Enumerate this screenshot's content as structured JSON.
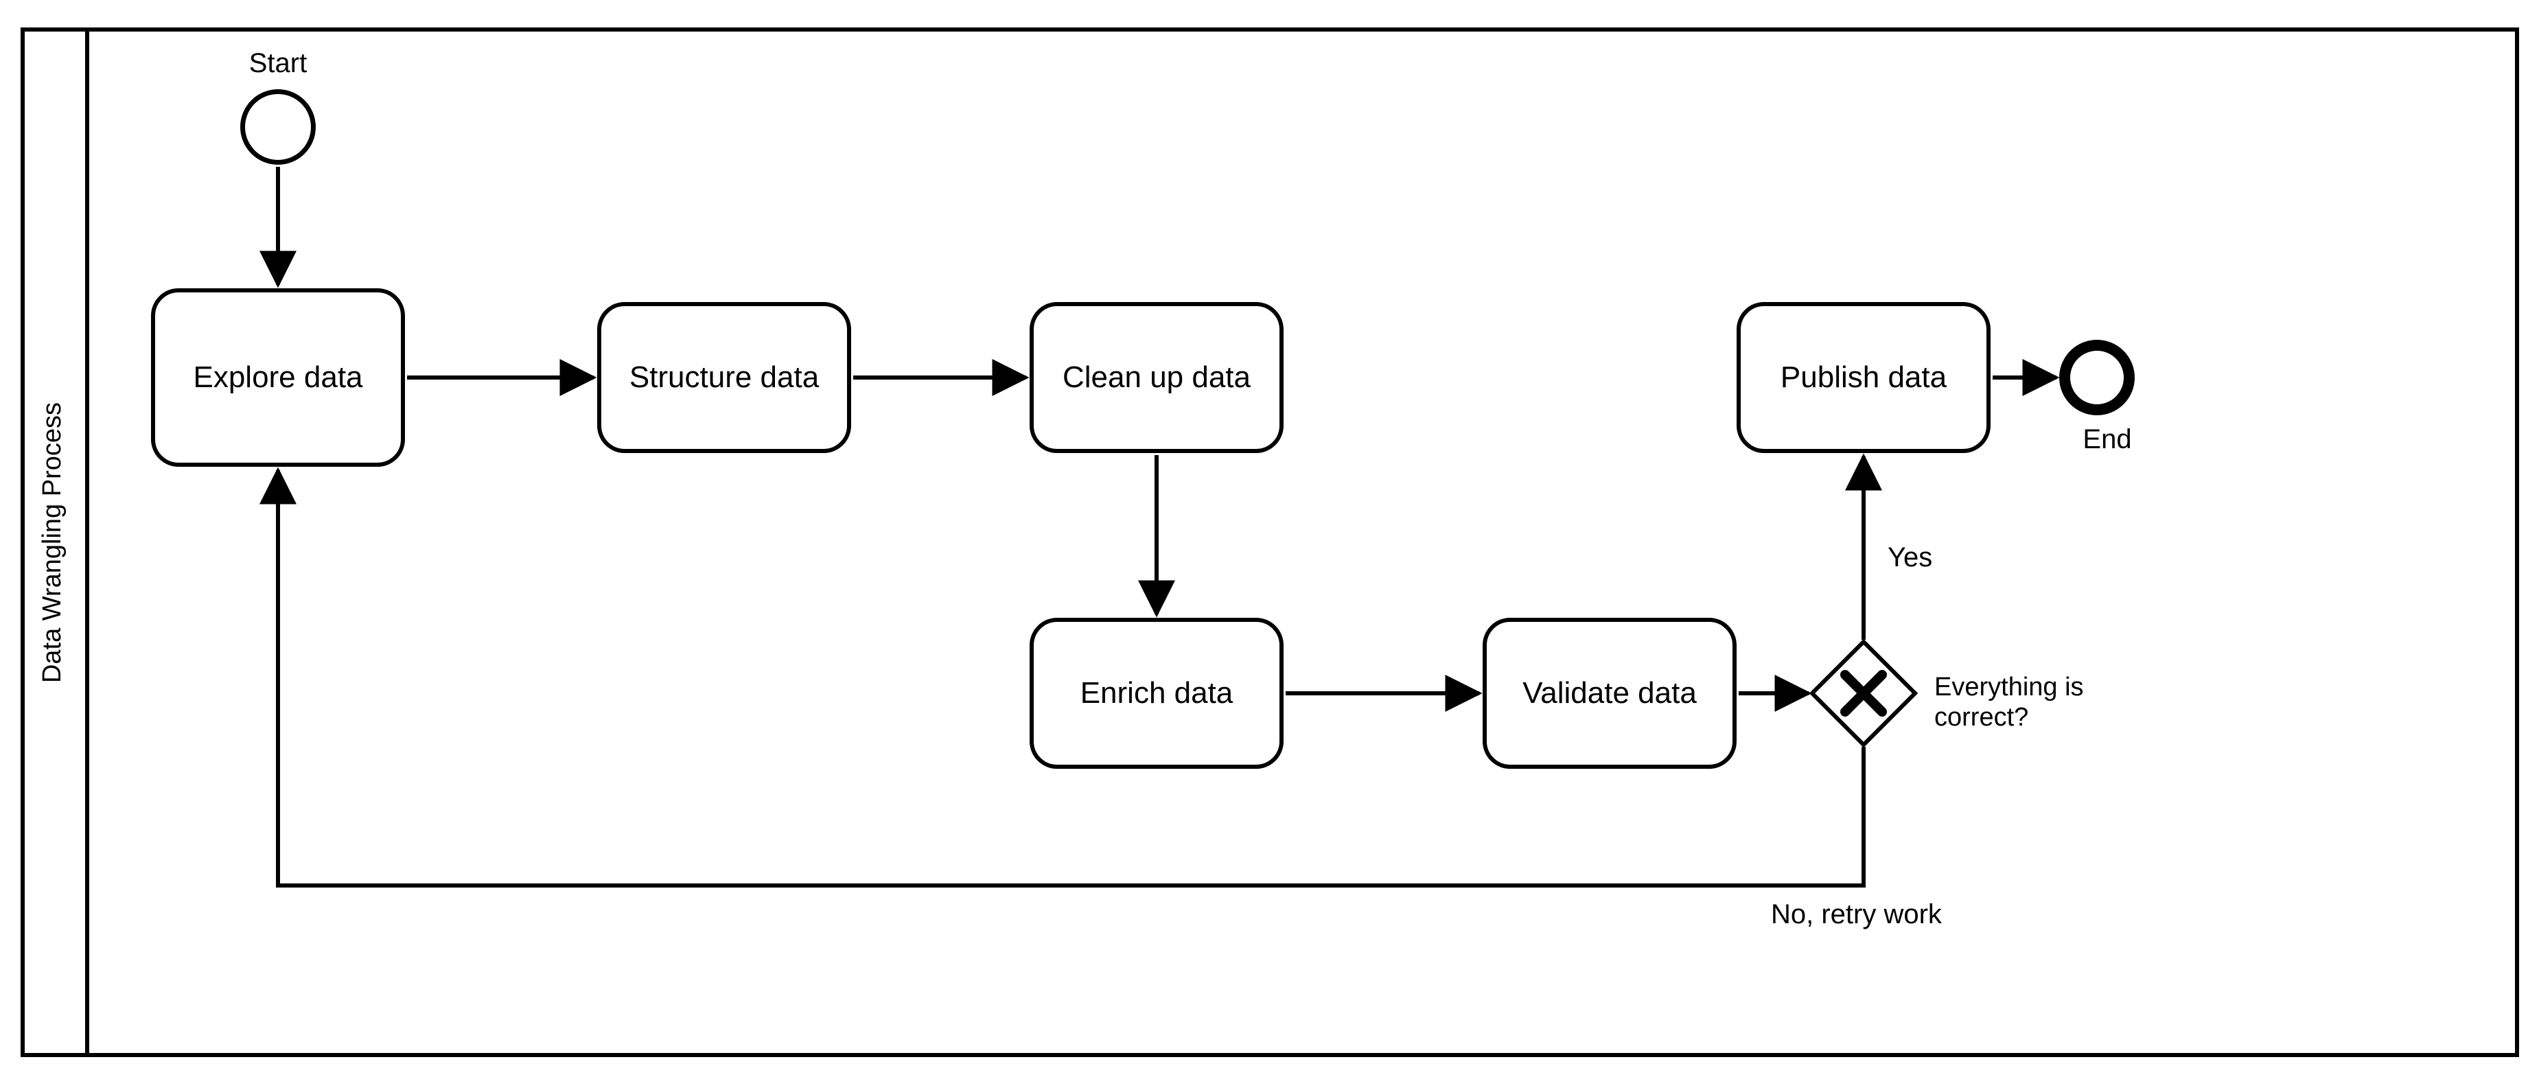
{
  "lane": {
    "title": "Data Wrangling Process"
  },
  "events": {
    "start": "Start",
    "end": "End"
  },
  "tasks": {
    "explore": "Explore data",
    "structure": "Structure data",
    "cleanup": "Clean up data",
    "enrich": "Enrich data",
    "validate": "Validate data",
    "publish": "Publish data"
  },
  "gateway": {
    "question": "Everything is correct?",
    "yes": "Yes",
    "no": "No, retry work"
  }
}
